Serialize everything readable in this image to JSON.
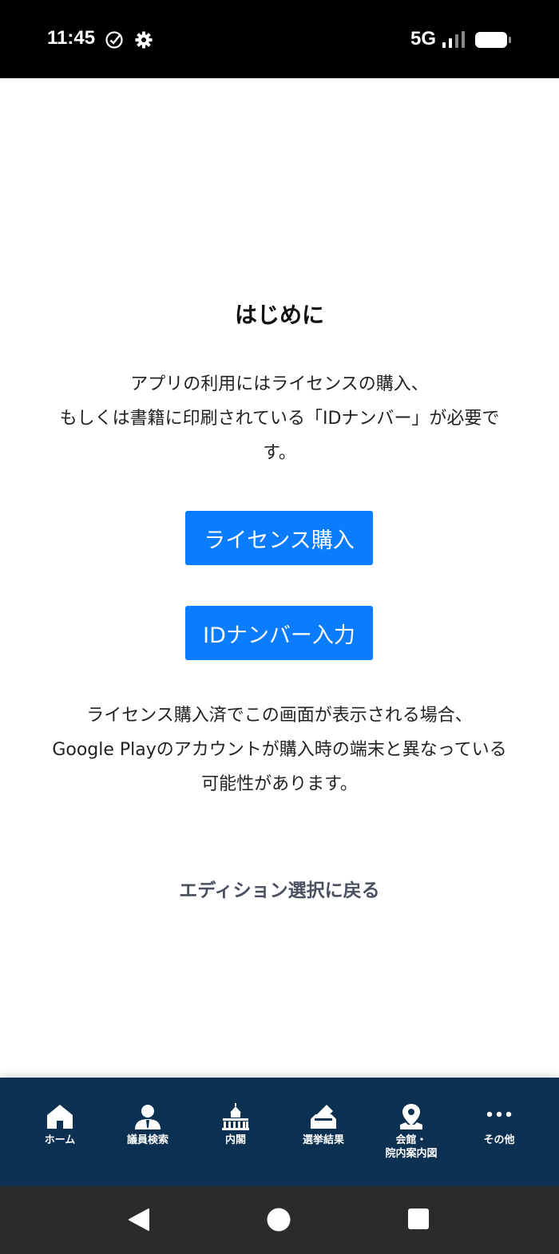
{
  "status_bar": {
    "time": "11:45",
    "network": "5G",
    "icons": [
      "check-circle-icon",
      "gear-icon",
      "signal-icon",
      "battery-icon"
    ]
  },
  "main": {
    "title": "はじめに",
    "intro_lines": [
      "アプリの利用にはライセンスの購入、",
      "もしくは書籍に印刷されている「IDナンバー」が必要で",
      "す。"
    ],
    "license_button": "ライセンス購入",
    "id_button": "IDナンバー入力",
    "note_lines": [
      "ライセンス購入済でこの画面が表示される場合、",
      "Google Playのアカウントが購入時の端末と異なっている",
      "可能性があります。"
    ],
    "back_link": "エディション選択に戻る",
    "accent_color": "#0a7cff"
  },
  "tab_bar": {
    "background": "#0c3052",
    "items": [
      {
        "label": "ホーム",
        "icon": "home-icon"
      },
      {
        "label": "議員検索",
        "icon": "person-icon"
      },
      {
        "label": "内閣",
        "icon": "diet-building-icon"
      },
      {
        "label": "選挙結果",
        "icon": "ballot-box-icon"
      },
      {
        "label_line1": "会館・",
        "label_line2": "院内案内図",
        "icon": "map-pin-icon"
      },
      {
        "label": "その他",
        "icon": "more-dots-icon"
      }
    ]
  },
  "system_nav": {
    "icons": [
      "back-icon",
      "home-circle-icon",
      "recents-icon"
    ]
  }
}
